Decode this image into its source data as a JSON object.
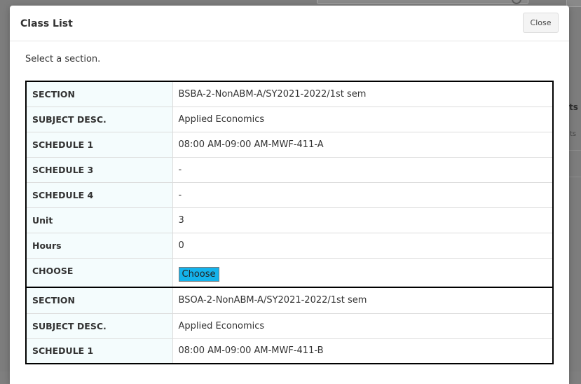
{
  "modal": {
    "title": "Class List",
    "close_label": "Close",
    "instruction": "Select a section."
  },
  "background": {
    "fragments": [
      "ts",
      "ts"
    ]
  },
  "sections": [
    {
      "rows": [
        {
          "label": "SECTION",
          "value": "BSBA-2-NonABM-A/SY2021-2022/1st sem"
        },
        {
          "label": "SUBJECT DESC.",
          "value": "Applied Economics"
        },
        {
          "label": "SCHEDULE 1",
          "value": "08:00 AM-09:00 AM-MWF-411-A"
        },
        {
          "label": "SCHEDULE 3",
          "value": "-"
        },
        {
          "label": "SCHEDULE 4",
          "value": "-"
        },
        {
          "label": "Unit",
          "value": "3"
        },
        {
          "label": "Hours",
          "value": "0"
        }
      ],
      "choose_label": "CHOOSE",
      "choose_button": "Choose"
    },
    {
      "rows": [
        {
          "label": "SECTION",
          "value": "BSOA-2-NonABM-A/SY2021-2022/1st sem"
        },
        {
          "label": "SUBJECT DESC.",
          "value": "Applied Economics"
        },
        {
          "label": "SCHEDULE 1",
          "value": "08:00 AM-09:00 AM-MWF-411-B"
        }
      ]
    }
  ]
}
